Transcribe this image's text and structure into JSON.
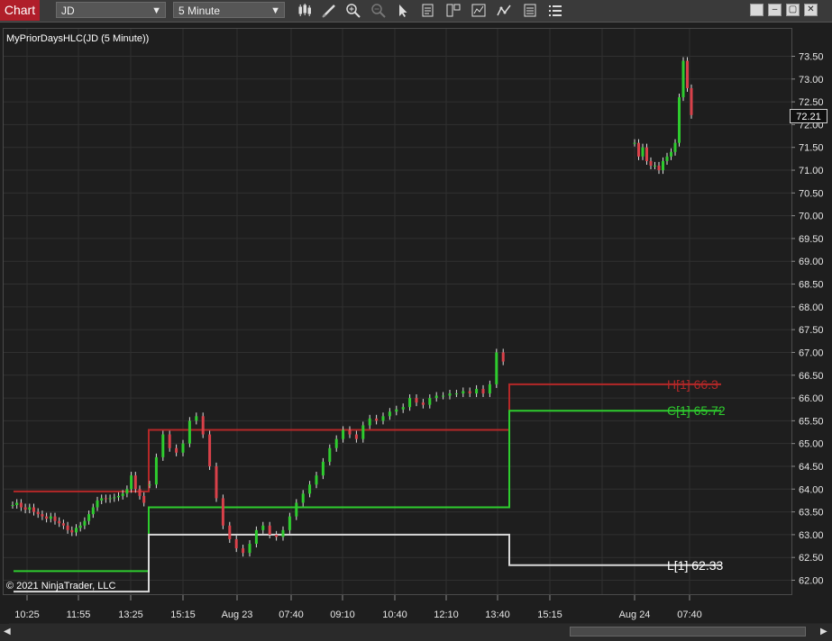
{
  "toolbar": {
    "chart_tab": "Chart",
    "instrument": "JD",
    "interval": "5 Minute",
    "icons": [
      "bar-type-icon",
      "drawing-tool-icon",
      "zoom-in-icon",
      "zoom-out-icon",
      "pointer-icon",
      "data-box-icon",
      "templates-icon",
      "strategies-icon",
      "indicators-icon",
      "properties-icon",
      "menu-icon"
    ]
  },
  "chart": {
    "indicator_label": "MyPriorDaysHLC(JD (5 Minute))",
    "copyright": "© 2021 NinjaTrader, LLC",
    "current_price": "72.21",
    "colors": {
      "background": "#1e1e1e",
      "high": "#b52828",
      "close": "#2ecc2e",
      "low": "#d8d8d8",
      "up_candle": "#2ecc2e",
      "down_candle": "#d9414a"
    },
    "line_labels": {
      "high": "H[1] 66.3",
      "close": "C[1] 65.72",
      "low": "L[1] 62.33"
    }
  },
  "chart_data": {
    "type": "line",
    "x_ticks": [
      "10:25",
      "11:55",
      "13:25",
      "15:15",
      "Aug 23",
      "07:40",
      "09:10",
      "10:40",
      "12:10",
      "13:40",
      "15:15",
      "Aug 24",
      "07:40"
    ],
    "y_ticks": [
      "73.50",
      "73.00",
      "72.50",
      "72.00",
      "71.50",
      "71.00",
      "70.50",
      "70.00",
      "69.50",
      "69.00",
      "68.50",
      "68.00",
      "67.50",
      "67.00",
      "66.50",
      "66.00",
      "65.50",
      "65.00",
      "64.50",
      "64.00",
      "63.50",
      "63.00",
      "62.50",
      "62.00"
    ],
    "ylim": [
      61.7,
      74.05
    ],
    "series": [
      {
        "name": "H[1]",
        "values": [
          63.95,
          65.3,
          66.3
        ]
      },
      {
        "name": "C[1]",
        "values": [
          62.2,
          63.6,
          65.72
        ]
      },
      {
        "name": "L[1]",
        "values": [
          61.75,
          63.0,
          62.33
        ]
      }
    ],
    "price_path": [
      [
        63.65,
        63.7,
        63.6,
        63.55,
        63.6,
        63.5,
        63.45,
        63.4,
        63.35,
        63.4,
        63.3,
        63.25,
        63.2,
        63.1,
        63.05,
        63.15,
        63.2,
        63.3,
        63.45,
        63.6,
        63.75,
        63.8,
        63.78,
        63.8,
        63.82,
        63.85,
        63.9,
        64.0,
        64.3,
        64.0,
        63.85,
        63.7
      ],
      [
        64.1,
        64.7,
        65.2,
        64.9,
        64.8,
        65.0,
        65.5,
        65.6,
        65.2,
        64.5,
        63.8,
        63.2,
        62.9,
        62.7,
        62.6,
        62.8,
        63.1,
        63.2,
        63.0,
        62.95,
        63.1,
        63.4,
        63.7,
        63.9,
        64.1,
        64.3,
        64.6,
        64.9,
        65.1,
        65.3,
        65.2,
        65.1,
        65.4,
        65.55,
        65.5,
        65.6,
        65.7,
        65.75,
        65.8,
        66.0,
        65.9,
        65.85,
        66.0,
        66.05,
        66.05,
        66.1,
        66.1,
        66.15,
        66.1,
        66.2,
        66.1,
        66.3,
        67.0,
        66.8
      ],
      [
        71.6,
        71.3,
        71.5,
        71.2,
        71.1,
        71.1,
        71.0,
        71.2,
        71.3,
        71.4,
        71.6,
        72.6,
        73.4,
        72.8,
        72.21
      ]
    ]
  },
  "scrollbar": {
    "left_arrow": "◀",
    "right_arrow": "▶"
  }
}
